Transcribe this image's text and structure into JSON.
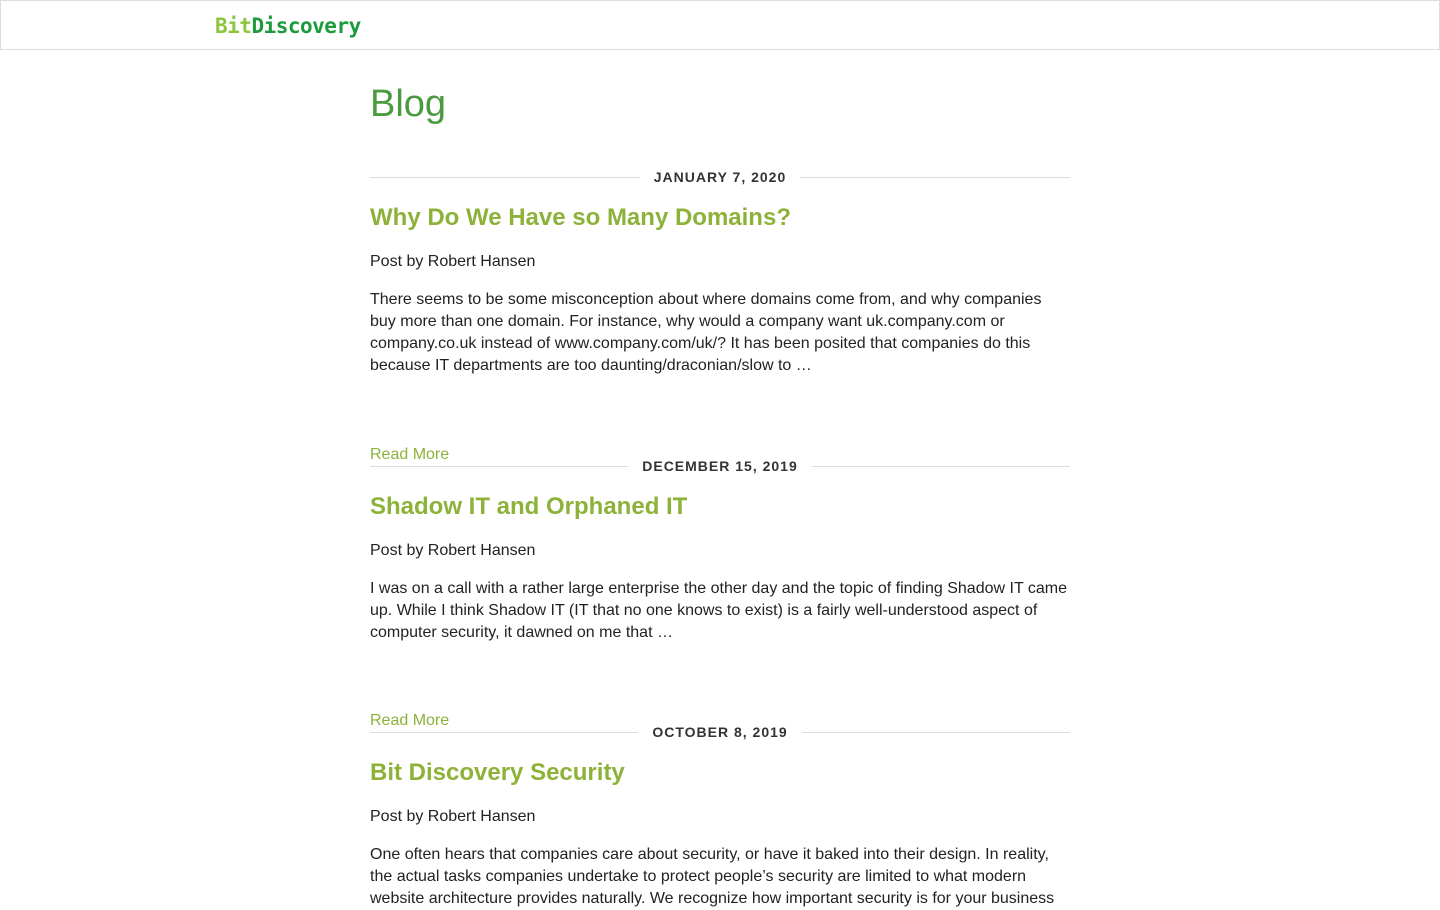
{
  "header": {
    "logo_bit": "Bit",
    "logo_discovery": "Discovery"
  },
  "page": {
    "title": "Blog"
  },
  "posts": [
    {
      "date": "JANUARY 7, 2020",
      "title": "Why Do We Have so Many Domains?",
      "author": "Post by Robert Hansen",
      "excerpt": "There seems to be some misconception about where domains come from, and why companies buy more than one domain. For instance, why would a company want uk.company.com or company.co.uk instead of www.company.com/uk/? It has been posited that companies do this because IT departments are too daunting/draconian/slow to …",
      "read_more": "Read More"
    },
    {
      "date": "DECEMBER 15, 2019",
      "title": "Shadow IT and Orphaned IT",
      "author": "Post by Robert Hansen",
      "excerpt": "I was on a call with a rather large enterprise the other day and the topic of finding Shadow IT came up. While I think Shadow IT (IT that no one knows to exist) is a fairly well-understood aspect of computer security, it dawned on me that …",
      "read_more": "Read More"
    },
    {
      "date": "OCTOBER 8, 2019",
      "title": "Bit Discovery Security",
      "author": "Post by Robert Hansen",
      "excerpt": "One often hears that companies care about security, or have it baked into their design. In reality, the actual tasks companies undertake to protect people’s security are limited to what modern website architecture provides naturally. We recognize how important security is for your business",
      "read_more": "Read More"
    }
  ],
  "colors": {
    "logo_light_green": "#8cc63f",
    "logo_dark_green": "#1c9a3c",
    "title_green": "#4a9a3f",
    "link_green": "#8db23a"
  }
}
